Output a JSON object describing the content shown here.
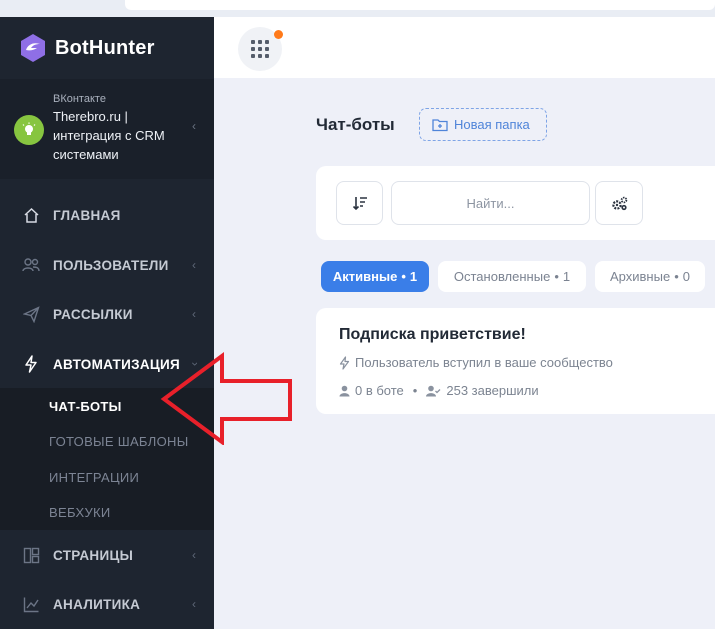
{
  "brand": {
    "name": "BotHunter"
  },
  "account": {
    "network": "ВКонтакте",
    "name": "Therebro.ru | интеграция с CRM системами"
  },
  "nav": {
    "home": "ГЛАВНАЯ",
    "users": "ПОЛЬЗОВАТЕЛИ",
    "mailings": "РАССЫЛКИ",
    "automation": "АВТОМАТИЗАЦИЯ",
    "pages": "СТРАНИЦЫ",
    "analytics": "АНАЛИТИКА"
  },
  "submenu": {
    "chatbots": "ЧАТ-БОТЫ",
    "templates": "ГОТОВЫЕ ШАБЛОНЫ",
    "integrations": "ИНТЕГРАЦИИ",
    "webhooks": "ВЕБХУКИ"
  },
  "page": {
    "title": "Чат-боты",
    "new_folder": "Новая папка",
    "search_placeholder": "Найти..."
  },
  "tabs": [
    {
      "label": "Активные",
      "count": "1"
    },
    {
      "label": "Остановленные",
      "count": "1"
    },
    {
      "label": "Архивные",
      "count": "0"
    }
  ],
  "tab_separator": "•",
  "bot": {
    "title": "Подписка приветствие!",
    "trigger": "Пользователь вступил в ваше сообщество",
    "in_bot": "0 в боте",
    "separator": "•",
    "finished": "253 завершили"
  },
  "colors": {
    "sidebar": "#1e2530",
    "accent": "#3a7ee8",
    "notification": "#ff7a1a",
    "annotation_arrow": "#e8202a"
  }
}
